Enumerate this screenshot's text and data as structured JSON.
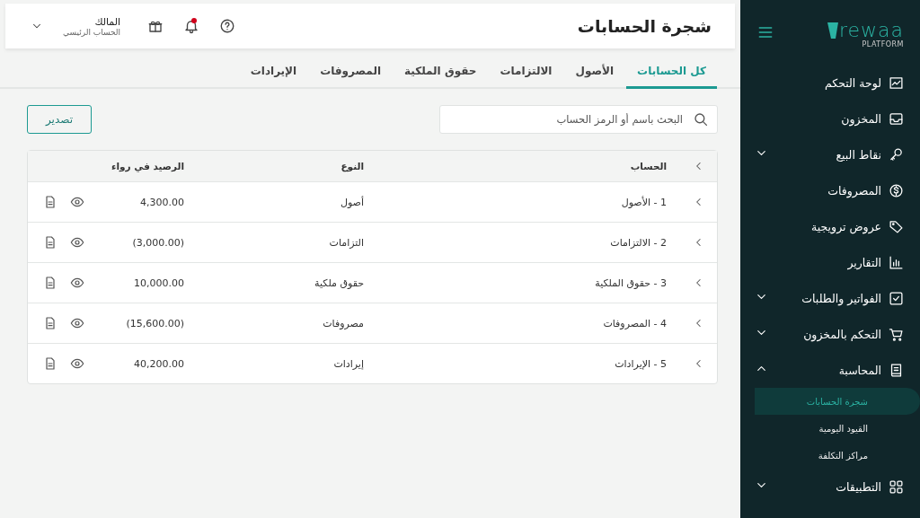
{
  "sidebar": {
    "logo": {
      "name": "rewaa",
      "subtitle": "PLATFORM"
    },
    "items": [
      {
        "label": "لوحة التحكم"
      },
      {
        "label": "المخزون"
      },
      {
        "label": "نقاط البيع",
        "expanded": false
      },
      {
        "label": "المصروفات"
      },
      {
        "label": "عروض ترويجية"
      },
      {
        "label": "التقارير"
      },
      {
        "label": "الفواتير والطلبات",
        "expanded": false
      },
      {
        "label": "التحكم بالمخزون",
        "expanded": false
      },
      {
        "label": "المحاسبة",
        "expanded": true,
        "children": [
          {
            "label": "شجرة الحسابات",
            "selected": true
          },
          {
            "label": "القيود اليومية",
            "selected": false
          },
          {
            "label": "مراكز التكلفة",
            "selected": false
          }
        ]
      },
      {
        "label": "التطبيقات",
        "expanded": false
      }
    ]
  },
  "header": {
    "title": "شجرة الحسابات",
    "user": {
      "name": "المالك",
      "role": "الحساب الرئيسي"
    },
    "has_notifications": true
  },
  "tabs": [
    {
      "label": "كل الحسابات",
      "selected": true
    },
    {
      "label": "الأصول",
      "selected": false
    },
    {
      "label": "الالتزامات",
      "selected": false
    },
    {
      "label": "حقوق الملكية",
      "selected": false
    },
    {
      "label": "المصروفات",
      "selected": false
    },
    {
      "label": "الإيرادات",
      "selected": false
    }
  ],
  "search": {
    "placeholder": "البحث باسم أو الرمز الحساب"
  },
  "export_button": "تصدير",
  "table": {
    "columns": [
      "الحساب",
      "النوع",
      "الرصيد في رواء"
    ],
    "rows": [
      {
        "account": "1 - الأصول",
        "type": "أصول",
        "balance": "4,300.00"
      },
      {
        "account": "2 - الالتزامات",
        "type": "التزامات",
        "balance": "(3,000.00)"
      },
      {
        "account": "3 - حقوق الملكية",
        "type": "حقوق ملكية",
        "balance": "10,000.00"
      },
      {
        "account": "4 - المصروفات",
        "type": "مصروفات",
        "balance": "(15,600.00)"
      },
      {
        "account": "5 - الإيرادات",
        "type": "إيرادات",
        "balance": "40,200.00"
      }
    ]
  }
}
